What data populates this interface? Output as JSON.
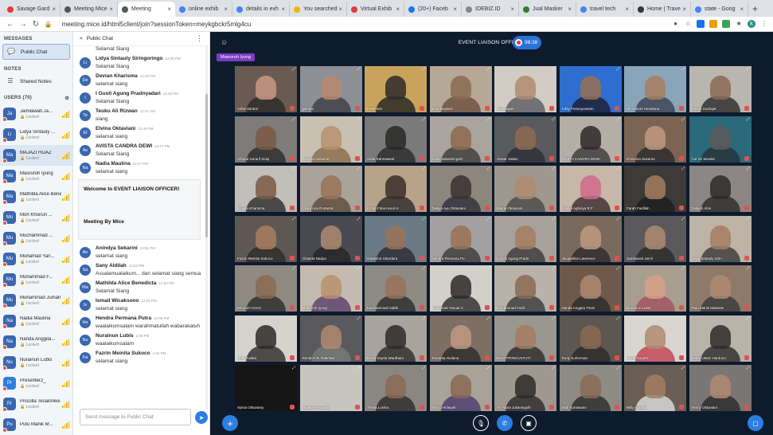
{
  "browser": {
    "tabs": [
      {
        "label": "Savage Gard",
        "color": "#e53935",
        "icon": "youtube-icon"
      },
      {
        "label": "Meeting Mice",
        "color": "#555",
        "icon": "site-icon"
      },
      {
        "label": "Meeting",
        "color": "#555",
        "icon": "site-icon",
        "active": true
      },
      {
        "label": "online exhib",
        "color": "#4285f4",
        "icon": "google-icon"
      },
      {
        "label": "details in exh",
        "color": "#4285f4",
        "icon": "google-icon"
      },
      {
        "label": "You searched",
        "color": "#f4b400",
        "icon": "site-icon"
      },
      {
        "label": "Virtual Exhib",
        "color": "#e53935",
        "icon": "site-icon"
      },
      {
        "label": "(20+) Faceb",
        "color": "#1877f2",
        "icon": "facebook-icon"
      },
      {
        "label": "IDEBIZ.ID",
        "color": "#888",
        "icon": "site-icon"
      },
      {
        "label": "Jual Masker",
        "color": "#2e7d32",
        "icon": "site-icon"
      },
      {
        "label": "travel tech",
        "color": "#4285f4",
        "icon": "google-icon"
      },
      {
        "label": "Home | Trave",
        "color": "#333",
        "icon": "site-icon"
      },
      {
        "label": "state - Goog",
        "color": "#4285f4",
        "icon": "google-icon"
      }
    ],
    "url": "meeting.mice.id/html5client/join?sessionToken=meykgbckr5mlg4cu",
    "profile_initial": "k"
  },
  "left_panel": {
    "messages_title": "MESSAGES",
    "public_chat": "Public Chat",
    "notes_title": "NOTES",
    "shared_notes": "Shared Notes",
    "users_title": "USERS (70)",
    "users": [
      {
        "initials": "Ja",
        "name": "Jamilawati Ja...",
        "status": "Locked",
        "color": "#3a67b0"
      },
      {
        "initials": "Li",
        "name": "Lidya Sintauly ...",
        "status": "Locked",
        "color": "#3a67b0"
      },
      {
        "initials": "Ma",
        "name": "MAJAZI HIJAZ",
        "status": "Locked",
        "color": "#3a67b0",
        "selected": true
      },
      {
        "initials": "Ma",
        "name": "Masruroh Iyung",
        "status": "Locked",
        "color": "#3a67b0"
      },
      {
        "initials": "Ma",
        "name": "Mathilda Alice Bene...",
        "status": "Locked",
        "color": "#3a67b0"
      },
      {
        "initials": "Mo",
        "name": "Moh Khoirun ...",
        "status": "Locked",
        "color": "#3a67b0"
      },
      {
        "initials": "Mu",
        "name": "Muchammad ...",
        "status": "Locked",
        "color": "#3a67b0"
      },
      {
        "initials": "Mu",
        "name": "Muhamad Yan...",
        "status": "Locked",
        "color": "#3a67b0"
      },
      {
        "initials": "Mu",
        "name": "Muhammad F...",
        "status": "Locked",
        "color": "#3a67b0"
      },
      {
        "initials": "Mu",
        "name": "Muhammad Jumah ...",
        "status": "Locked",
        "color": "#3a67b0"
      },
      {
        "initials": "Na",
        "name": "Nadia Maulina",
        "status": "Locked",
        "color": "#3a67b0"
      },
      {
        "initials": "Na",
        "name": "Nanda Anggita...",
        "status": "Locked",
        "color": "#3a67b0"
      },
      {
        "initials": "Nu",
        "name": "Nurainun Lubis",
        "status": "Locked",
        "color": "#3a67b0"
      },
      {
        "initials": "Pr",
        "name": "Presenter2_",
        "status": "Locked",
        "color": "#2d7ee0"
      },
      {
        "initials": "Pr",
        "name": "Priscilla Tesalonike ...",
        "status": "Locked",
        "color": "#3a67b0"
      },
      {
        "initials": "Pu",
        "name": "Putu Manik M...",
        "status": "",
        "color": "#3a67b0"
      }
    ]
  },
  "chat": {
    "title": "Public Chat",
    "messages_top": [
      {
        "initials": "",
        "name": "",
        "time": "",
        "text": "Selamat Siang"
      },
      {
        "initials": "Li",
        "name": "Lidya Sintauly Siringoringo",
        "time": "12:30 PM",
        "text": "Selamat Siang"
      },
      {
        "initials": "De",
        "name": "Devian Kharisma",
        "time": "12:30 PM",
        "text": "selamat siang"
      },
      {
        "initials": "I",
        "name": "I Gusti Agung Pradnyadari",
        "time": "12:30 PM",
        "text": "Selamat Siang"
      },
      {
        "initials": "Te",
        "name": "Teuku Ali Rizwan",
        "time": "12:41 PM",
        "text": "siang"
      },
      {
        "initials": "El",
        "name": "Elvina Oktaviani",
        "time": "12:45 PM",
        "text": "selamat siang"
      },
      {
        "initials": "Av",
        "name": "AVISTA CANDRA DEWI",
        "time": "12:47 PM",
        "text": "Selamat Siang"
      },
      {
        "initials": "Na",
        "name": "Nadia Maulina",
        "time": "12:47 PM",
        "text": "selamat siang"
      }
    ],
    "welcome_line1": "Welcome to EVENT LIAISON OFFICER!",
    "welcome_line2": "Meeting By Mice",
    "messages_bottom": [
      {
        "initials": "An",
        "name": "Anindya Sekarini",
        "time": "12:51 PM",
        "text": "selamat siang"
      },
      {
        "initials": "Sa",
        "name": "Sany Aldilah",
        "time": "12:52 PM",
        "text": "Assalamualaikum... dan selamat siang semua"
      },
      {
        "initials": "Ma",
        "name": "Mathilda Alice Benedicta",
        "time": "12:53 PM",
        "text": "Selamat Siang"
      },
      {
        "initials": "Is",
        "name": "Ismail Wicaksono",
        "time": "12:53 PM",
        "text": "selamat siang"
      },
      {
        "initials": "He",
        "name": "Hendra Permana Putra",
        "time": "12:56 PM",
        "text": "waalaikumsalam warahmatullah wabarakatuh"
      },
      {
        "initials": "Nu",
        "name": "Nurainun Lubis",
        "time": "1:06 PM",
        "text": "waalaikumsalam"
      },
      {
        "initials": "Fa",
        "name": "Fazrin Meinita Sukoco",
        "time": "1:06 PM",
        "text": "selamat siang"
      }
    ],
    "input_placeholder": "Send message to Public Chat"
  },
  "meeting": {
    "title": "EVENT LIAISON OFFICER",
    "timer": "98:38",
    "talking": "Masruroh Iyung",
    "participants": [
      {
        "name": "Administrator",
        "bg": "#6b5a52",
        "skin": "#c99a82",
        "shirt": "#2b2b2b"
      },
      {
        "name": "gisheia",
        "bg": "#8c8f96",
        "skin": "#b98a6e",
        "shirt": "#3d3d45"
      },
      {
        "name": "Presenter",
        "bg": "#c9a35c",
        "skin": "#2f2a2a",
        "shirt": "#222"
      },
      {
        "name": "Elsa Maylani",
        "bg": "#b7a796",
        "skin": "#8a6a52",
        "shirt": "#6b4f3d"
      },
      {
        "name": "wuwangan",
        "bg": "#d2ccc4",
        "skin": "#b08a70",
        "shirt": "#5a5a60"
      },
      {
        "name": "Addy Purwoyunanto",
        "bg": "#2d6ed0",
        "skin": "#9a6e50",
        "shirt": "#1d1d2a"
      },
      {
        "name": "Afni Wiarti Hendiana",
        "bg": "#8aa5b9",
        "skin": "#a87e5e",
        "shirt": "#384050"
      },
      {
        "name": "Adrian Sudrajat",
        "bg": "#b9b6b0",
        "skin": "#8a6a52",
        "shirt": "#2a2a2a"
      },
      {
        "name": "Ahmad Nurarif Sidqi",
        "bg": "#7e7b78",
        "skin": "#7a5a44",
        "shirt": "#2c2c2c"
      },
      {
        "name": "Anindya Sekarini",
        "bg": "#c8c0b2",
        "skin": "#b8916c",
        "shirt": "#8a6a4a"
      },
      {
        "name": "Anita Rahmawati",
        "bg": "#7a7a7a",
        "skin": "#2c2828",
        "shirt": "#2a2a2a"
      },
      {
        "name": "Anita Sabatiningsih",
        "bg": "#a9a49d",
        "skin": "#8e6a50",
        "shirt": "#3b3b3b"
      },
      {
        "name": "Anwar Salam",
        "bg": "#595a5e",
        "skin": "#8e6a50",
        "shirt": "#2d2d36"
      },
      {
        "name": "AVISTA CANDRA DEWI",
        "bg": "#b4aea7",
        "skin": "#302828",
        "shirt": "#3a3a3a"
      },
      {
        "name": "Christina Susanto",
        "bg": "#7c6454",
        "skin": "#c09a80",
        "shirt": "#2a2a2a"
      },
      {
        "name": "Cut Sri Maisita",
        "bg": "#2b6a7a",
        "skin": "#5e5a5a",
        "shirt": "#263238"
      },
      {
        "name": "Devian Kharisma",
        "bg": "#c2beb8",
        "skin": "#7a5a44",
        "shirt": "#2c2c2c"
      },
      {
        "name": "Dhika Aria Putranta",
        "bg": "#a9a39a",
        "skin": "#9a7256",
        "shirt": "#5b4a3a"
      },
      {
        "name": "Dinda Fitria Hurul H",
        "bg": "#b8a289",
        "skin": "#3a2e2a",
        "shirt": "#2b2b2b"
      },
      {
        "name": "Dwitya Ayu Oktaviani",
        "bg": "#8d867d",
        "skin": "#3a3030",
        "shirt": "#30303a"
      },
      {
        "name": "Elvina Oktaviani",
        "bg": "#9e988f",
        "skin": "#b08a70",
        "shirt": "#4a4a4a"
      },
      {
        "name": "Fakhul Aghniya R.F",
        "bg": "#c6b7a8",
        "skin": "#d06a8a",
        "shirt": "#3a2a2a"
      },
      {
        "name": "Farah Fadillah",
        "bg": "#3d3a38",
        "skin": "#a47c60",
        "shirt": "#1e1e1e"
      },
      {
        "name": "Fatiyah Abis",
        "bg": "#8c8784",
        "skin": "#2e2a2a",
        "shirt": "#2a2a2a"
      },
      {
        "name": "Fazrin Meinita Sukoco",
        "bg": "#5e5854",
        "skin": "#a87e5e",
        "shirt": "#2c2c2c"
      },
      {
        "name": "Ghaeda Nadya",
        "bg": "#4a4a52",
        "skin": "#b08a70",
        "shirt": "#242428"
      },
      {
        "name": "Ganesha Gitardara",
        "bg": "#6a7a84",
        "skin": "#9a7256",
        "shirt": "#2a2a34"
      },
      {
        "name": "Hendra Permana Pu",
        "bg": "#a2a0a0",
        "skin": "#9a7256",
        "shirt": "#3a3a3a"
      },
      {
        "name": "I Gusti Agung Pradn",
        "bg": "#a6a19a",
        "skin": "#a47c60",
        "shirt": "#3a3a3a"
      },
      {
        "name": "Jacqueline Lawrence",
        "bg": "#7a6a5e",
        "skin": "#c09a80",
        "shirt": "#2a2a2a"
      },
      {
        "name": "Jamilawati Jamil",
        "bg": "#5a5a5c",
        "skin": "#b08a70",
        "shirt": "#2a2a2a"
      },
      {
        "name": "Lidya Sintauly Sirin",
        "bg": "#bdb3a6",
        "skin": "#a47c60",
        "shirt": "#3a3a3a"
      },
      {
        "name": "MAJAZI HIJAZ",
        "bg": "#8e8a82",
        "skin": "#8a6a52",
        "shirt": "#2a2a2a"
      },
      {
        "name": "Masruroh Iyung",
        "bg": "#c4bbb0",
        "skin": "#b8916c",
        "shirt": "#5a3e6a"
      },
      {
        "name": "Muchammad Habib",
        "bg": "#8e8a84",
        "skin": "#9a7256",
        "shirt": "#2a2a2a"
      },
      {
        "name": "Muhamad Yanuar A",
        "bg": "#d3cfc9",
        "skin": "#2a2a2a",
        "shirt": "#2a2a2a"
      },
      {
        "name": "Muhammad Fadil",
        "bg": "#b8b2a8",
        "skin": "#8a6a52",
        "shirt": "#3a3a3a"
      },
      {
        "name": "Nanda Anggita Triani",
        "bg": "#6e5a4c",
        "skin": "#b08a70",
        "shirt": "#2a2a2a"
      },
      {
        "name": "Nurainun Lubis",
        "bg": "#a89e90",
        "skin": "#d7a088",
        "shirt": "#a05060"
      },
      {
        "name": "Putu Manik Mahasw",
        "bg": "#8e7a6a",
        "skin": "#b08a70",
        "shirt": "#3a3a3a"
      },
      {
        "name": "Rani Yunika",
        "bg": "#d6d2cc",
        "skin": "#2e2a2a",
        "shirt": "#2a2a2a"
      },
      {
        "name": "Renda F.R. Rukman",
        "bg": "#5a5a5e",
        "skin": "#b08a70",
        "shirt": "#7a7a7a"
      },
      {
        "name": "Rizka Septia Wardhani",
        "bg": "#a8a39c",
        "skin": "#2e2a2a",
        "shirt": "#2a2a2a"
      },
      {
        "name": "Rosanta Atsilana",
        "bg": "#7e6e64",
        "skin": "#c09a80",
        "shirt": "#2a2a2a"
      },
      {
        "name": "RUDI PRINCUSTUTI",
        "bg": "#9a9690",
        "skin": "#a47c60",
        "shirt": "#2a2a2a"
      },
      {
        "name": "Rudy Suherman",
        "bg": "#5e5650",
        "skin": "#8a6a52",
        "shirt": "#2a2a2a"
      },
      {
        "name": "Salfia Gayatri",
        "bg": "#d9d6d2",
        "skin": "#b08a70",
        "shirt": "#c04050"
      },
      {
        "name": "Sekar Utami Hardono",
        "bg": "#b9b3aa",
        "skin": "#2e2a2a",
        "shirt": "#2a2a2a"
      },
      {
        "name": "Sylvia Oktaviany",
        "bg": "#151515",
        "skin": "#151515",
        "shirt": "#151515"
      },
      {
        "name": "Teuku Ali Rizwan",
        "bg": "#c8c4be",
        "skin": "#c8c4be",
        "shirt": "#c8c4be"
      },
      {
        "name": "Thesa Lonika",
        "bg": "#8a8680",
        "skin": "#8a6a52",
        "shirt": "#2a2a2a"
      },
      {
        "name": "Toruni Hidayah",
        "bg": "#a8a298",
        "skin": "#8a6a52",
        "shirt": "#4a3a6a"
      },
      {
        "name": "Tri Yopra Julianingsih",
        "bg": "#9e9890",
        "skin": "#2e2a2a",
        "shirt": "#2a2a2a"
      },
      {
        "name": "Widi Kurniawan",
        "bg": "#8e8a84",
        "skin": "#8a6a52",
        "shirt": "#2a2a2a"
      },
      {
        "name": "Willy Aprianti",
        "bg": "#6a5e54",
        "skin": "#a47c60",
        "shirt": "#e0e0e0"
      },
      {
        "name": "Yenny Oktaviani",
        "bg": "#7a7674",
        "skin": "#b08a70",
        "shirt": "#2a2a2a"
      }
    ]
  }
}
